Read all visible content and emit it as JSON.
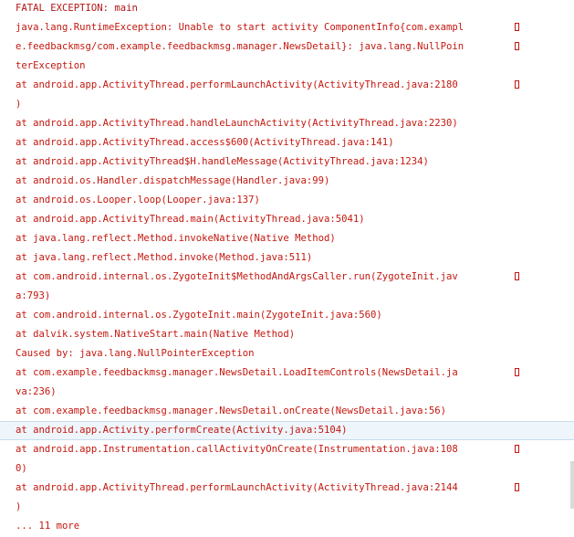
{
  "log": {
    "lines": [
      {
        "text": "FATAL EXCEPTION: main",
        "wrap_marker": false
      },
      {
        "text": "java.lang.RuntimeException: Unable to start activity ComponentInfo{com.exampl",
        "wrap_marker": true
      },
      {
        "text": "e.feedbackmsg/com.example.feedbackmsg.manager.NewsDetail}: java.lang.NullPoin",
        "wrap_marker": true
      },
      {
        "text": "terException",
        "wrap_marker": false
      },
      {
        "text": "at android.app.ActivityThread.performLaunchActivity(ActivityThread.java:2180",
        "wrap_marker": true
      },
      {
        "text": ")",
        "wrap_marker": false
      },
      {
        "text": "at android.app.ActivityThread.handleLaunchActivity(ActivityThread.java:2230)",
        "wrap_marker": false
      },
      {
        "text": "at android.app.ActivityThread.access$600(ActivityThread.java:141)",
        "wrap_marker": false
      },
      {
        "text": "at android.app.ActivityThread$H.handleMessage(ActivityThread.java:1234)",
        "wrap_marker": false
      },
      {
        "text": "at android.os.Handler.dispatchMessage(Handler.java:99)",
        "wrap_marker": false
      },
      {
        "text": "at android.os.Looper.loop(Looper.java:137)",
        "wrap_marker": false
      },
      {
        "text": "at android.app.ActivityThread.main(ActivityThread.java:5041)",
        "wrap_marker": false
      },
      {
        "text": "at java.lang.reflect.Method.invokeNative(Native Method)",
        "wrap_marker": false
      },
      {
        "text": "at java.lang.reflect.Method.invoke(Method.java:511)",
        "wrap_marker": false
      },
      {
        "text": "at com.android.internal.os.ZygoteInit$MethodAndArgsCaller.run(ZygoteInit.jav",
        "wrap_marker": true
      },
      {
        "text": "a:793)",
        "wrap_marker": false
      },
      {
        "text": "at com.android.internal.os.ZygoteInit.main(ZygoteInit.java:560)",
        "wrap_marker": false
      },
      {
        "text": "at dalvik.system.NativeStart.main(Native Method)",
        "wrap_marker": false
      },
      {
        "text": "Caused by: java.lang.NullPointerException",
        "wrap_marker": false
      },
      {
        "text": "at com.example.feedbackmsg.manager.NewsDetail.LoadItemControls(NewsDetail.ja",
        "wrap_marker": true
      },
      {
        "text": "va:236)",
        "wrap_marker": false
      },
      {
        "text": "at com.example.feedbackmsg.manager.NewsDetail.onCreate(NewsDetail.java:56)",
        "wrap_marker": false
      },
      {
        "text": "at android.app.Activity.performCreate(Activity.java:5104)",
        "wrap_marker": false,
        "selected": true
      },
      {
        "text": "at android.app.Instrumentation.callActivityOnCreate(Instrumentation.java:108",
        "wrap_marker": true
      },
      {
        "text": "0)",
        "wrap_marker": false
      },
      {
        "text": "at android.app.ActivityThread.performLaunchActivity(ActivityThread.java:2144",
        "wrap_marker": true
      },
      {
        "text": ")",
        "wrap_marker": false
      },
      {
        "text": "... 11 more",
        "wrap_marker": false
      }
    ]
  },
  "colors": {
    "log_text": "#c4170f",
    "selection_background": "#eef5fb"
  },
  "icons": {
    "wrap_marker": "line-wrap-box-icon"
  }
}
